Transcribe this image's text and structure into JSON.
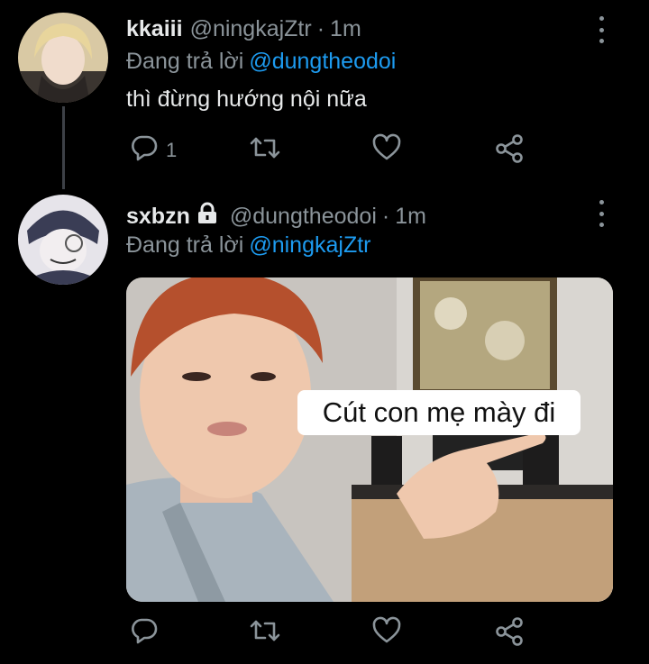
{
  "tweets": [
    {
      "name": "kkaiii",
      "handle": "@ningkajZtr",
      "time": "1m",
      "replying_prefix": "Đang trả lời",
      "replying_to": "@dungtheodoi",
      "text": "thì đừng hướng nội nữa",
      "reply_count": "1"
    },
    {
      "name": "sxbzn",
      "handle": "@dungtheodoi",
      "time": "1m",
      "replying_prefix": "Đang trả lời",
      "replying_to": "@ningkajZtr",
      "media_caption": "Cút con mẹ mày đi"
    }
  ],
  "separator": "·",
  "colors": {
    "background": "#000000",
    "text": "#e7e9ea",
    "muted": "#8b949a",
    "mention": "#1d9bf0"
  },
  "icons": [
    "reply-icon",
    "retweet-icon",
    "like-icon",
    "share-icon",
    "more-icon",
    "lock-icon"
  ]
}
